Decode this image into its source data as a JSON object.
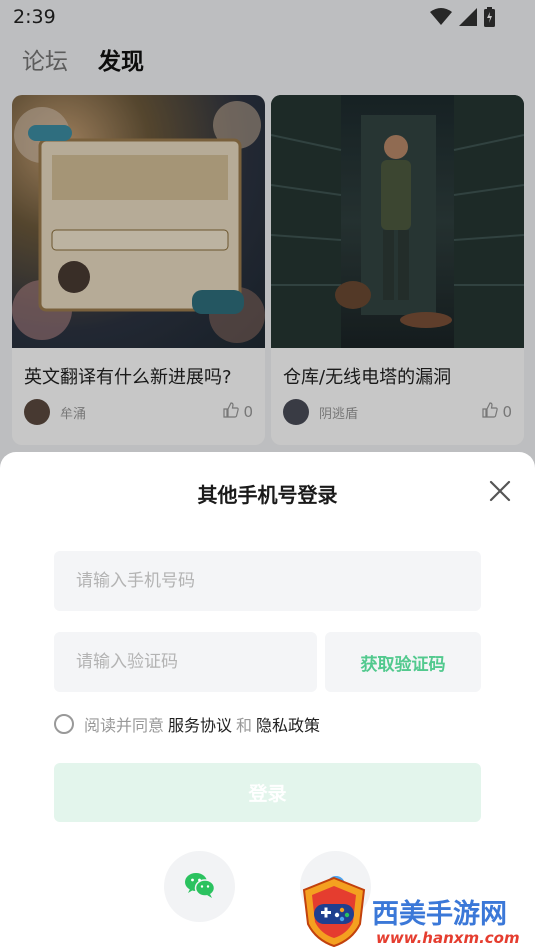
{
  "status_bar": {
    "time": "2:39"
  },
  "top_tabs": [
    {
      "label": "论坛",
      "active": false
    },
    {
      "label": "发现",
      "active": true
    }
  ],
  "feed": {
    "cards": [
      {
        "title": "英文翻译有什么新进展吗?",
        "author": "牟涌",
        "likes": "0"
      },
      {
        "title": "仓库/无线电塔的漏洞",
        "author": "阴逃盾",
        "likes": "0"
      }
    ]
  },
  "login_sheet": {
    "title": "其他手机号登录",
    "phone_placeholder": "请输入手机号码",
    "code_placeholder": "请输入验证码",
    "get_code_label": "获取验证码",
    "agree_prefix": "阅读并同意",
    "terms_label": "服务协议",
    "and_label": "和",
    "privacy_label": "隐私政策",
    "login_label": "登录"
  },
  "icons": {
    "close": "close-icon",
    "wechat": "wechat-icon",
    "like": "thumb-up-icon",
    "wifi": "wifi-icon",
    "signal": "signal-icon",
    "battery": "battery-icon"
  },
  "watermark": {
    "brand": "西美手游网",
    "url": "www.hanxm.com"
  },
  "colors": {
    "accent": "#52c98e",
    "login_disabled_bg": "#e3f5ec",
    "field_bg": "#f4f5f7",
    "watermark_blue": "#3b78d8",
    "watermark_red": "#e53d2f"
  }
}
